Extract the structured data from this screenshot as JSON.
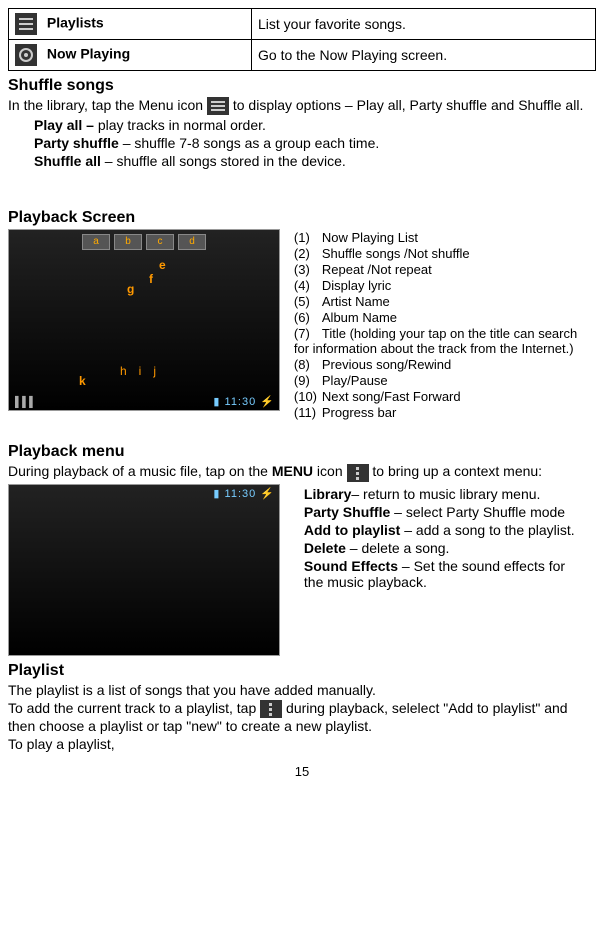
{
  "page_number": "15",
  "table": {
    "rows": [
      {
        "label": "Playlists",
        "desc": "List your favorite songs."
      },
      {
        "label": "Now Playing",
        "desc": "Go to the Now Playing screen."
      }
    ]
  },
  "shuffle": {
    "heading": "Shuffle songs",
    "intro_pre": "In the library, tap the Menu icon ",
    "intro_post": " to display options – Play all, Party shuffle and Shuffle all.",
    "items": [
      {
        "term": "Play all – ",
        "desc": "play tracks in normal order."
      },
      {
        "term": "Party shuffle",
        "desc": " – shuffle 7-8 songs as a group each time."
      },
      {
        "term": "Shuffle all",
        "desc": " – shuffle all songs stored in the device."
      }
    ]
  },
  "playback_screen": {
    "heading": "Playback Screen",
    "time": "11:30",
    "letters": [
      "a",
      "b",
      "c",
      "d",
      "e",
      "f",
      "g",
      "h",
      "i",
      "j",
      "k"
    ],
    "legend": [
      {
        "n": "(1)",
        "t": "Now Playing List"
      },
      {
        "n": "(2)",
        "t": "Shuffle songs /Not shuffle"
      },
      {
        "n": "(3)",
        "t": "Repeat /Not repeat"
      },
      {
        "n": "(4)",
        "t": "Display lyric"
      },
      {
        "n": "(5)",
        "t": "Artist Name"
      },
      {
        "n": "(6)",
        "t": "Album Name"
      },
      {
        "n": "(7)",
        "t": "Title (holding your tap on the title can search for information about the track from the Internet.)"
      },
      {
        "n": "(8)",
        "t": "Previous song/Rewind"
      },
      {
        "n": "(9)",
        "t": "Play/Pause"
      },
      {
        "n": "(10)",
        "t": "Next song/Fast Forward"
      },
      {
        "n": "(11)",
        "t": "Progress bar"
      }
    ]
  },
  "playback_menu": {
    "heading": "Playback menu",
    "intro_pre": "During playback of a music file, tap on the ",
    "menu_word": "MENU",
    "intro_mid": " icon ",
    "intro_post": " to bring up a context menu:",
    "items": [
      {
        "term": "Library",
        "desc": "– return to music library menu."
      },
      {
        "term": "Party Shuffle",
        "desc": " – select Party Shuffle mode"
      },
      {
        "term": "Add to playlist",
        "desc": " – add a song to the playlist."
      },
      {
        "term": "Delete",
        "desc": " – delete a song."
      },
      {
        "term": "Sound Effects",
        "desc": " – Set the sound effects for the music playback."
      }
    ]
  },
  "playlist": {
    "heading": "Playlist",
    "line1": "The playlist is a list of songs that you have added manually.",
    "line2_pre": "To add the current track to a playlist, tap ",
    "line2_post": " during playback, selelect \"Add to playlist\" and then choose a playlist or tap \"new\" to create a new playlist.",
    "line3": "To play a playlist,"
  }
}
